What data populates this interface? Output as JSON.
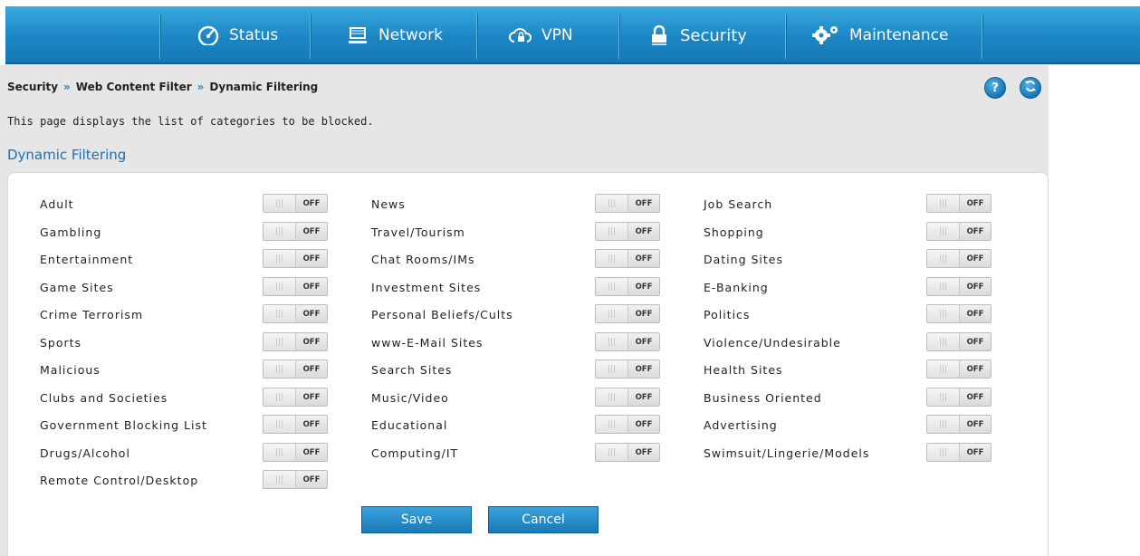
{
  "nav": {
    "items": [
      {
        "label": "Status",
        "icon": "gauge-icon"
      },
      {
        "label": "Network",
        "icon": "monitor-icon"
      },
      {
        "label": "VPN",
        "icon": "cloud-lock-icon"
      },
      {
        "label": "Security",
        "icon": "padlock-icon"
      },
      {
        "label": "Maintenance",
        "icon": "gears-icon"
      }
    ],
    "active": "Security"
  },
  "breadcrumb": {
    "items": [
      "Security",
      "Web Content Filter",
      "Dynamic Filtering"
    ],
    "separator": "»"
  },
  "help_icon": "?",
  "description": "This page displays the list of categories to be blocked.",
  "section_title": "Dynamic Filtering",
  "toggle_off_label": "OFF",
  "toggle_grip": "|||",
  "columns": [
    [
      {
        "label": "Adult",
        "state": "OFF"
      },
      {
        "label": "Gambling",
        "state": "OFF"
      },
      {
        "label": "Entertainment",
        "state": "OFF"
      },
      {
        "label": "Game Sites",
        "state": "OFF"
      },
      {
        "label": "Crime Terrorism",
        "state": "OFF"
      },
      {
        "label": "Sports",
        "state": "OFF"
      },
      {
        "label": "Malicious",
        "state": "OFF"
      },
      {
        "label": "Clubs and Societies",
        "state": "OFF"
      },
      {
        "label": "Government Blocking List",
        "state": "OFF"
      },
      {
        "label": "Drugs/Alcohol",
        "state": "OFF"
      },
      {
        "label": "Remote Control/Desktop",
        "state": "OFF"
      }
    ],
    [
      {
        "label": "News",
        "state": "OFF"
      },
      {
        "label": "Travel/Tourism",
        "state": "OFF"
      },
      {
        "label": "Chat Rooms/IMs",
        "state": "OFF"
      },
      {
        "label": "Investment Sites",
        "state": "OFF"
      },
      {
        "label": "Personal Beliefs/Cults",
        "state": "OFF"
      },
      {
        "label": "www-E-Mail Sites",
        "state": "OFF"
      },
      {
        "label": "Search Sites",
        "state": "OFF"
      },
      {
        "label": "Music/Video",
        "state": "OFF"
      },
      {
        "label": "Educational",
        "state": "OFF"
      },
      {
        "label": "Computing/IT",
        "state": "OFF"
      }
    ],
    [
      {
        "label": "Job Search",
        "state": "OFF"
      },
      {
        "label": "Shopping",
        "state": "OFF"
      },
      {
        "label": "Dating Sites",
        "state": "OFF"
      },
      {
        "label": "E-Banking",
        "state": "OFF"
      },
      {
        "label": "Politics",
        "state": "OFF"
      },
      {
        "label": "Violence/Undesirable",
        "state": "OFF"
      },
      {
        "label": "Health Sites",
        "state": "OFF"
      },
      {
        "label": "Business Oriented",
        "state": "OFF"
      },
      {
        "label": "Advertising",
        "state": "OFF"
      },
      {
        "label": "Swimsuit/Lingerie/Models",
        "state": "OFF"
      }
    ]
  ],
  "buttons": {
    "save": "Save",
    "cancel": "Cancel"
  },
  "colors": {
    "nav_blue": "#1b86c4",
    "accent": "#1e6fae",
    "panel": "#e6e6e6"
  }
}
